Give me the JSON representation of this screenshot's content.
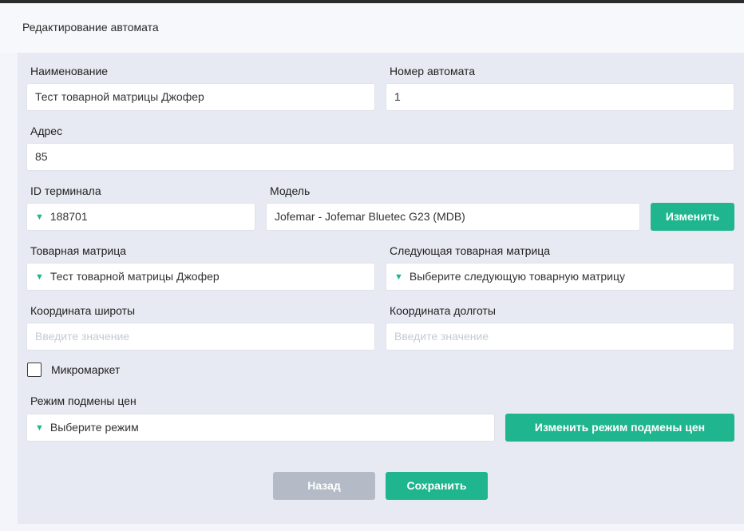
{
  "header": {
    "title": "Редактирование автомата"
  },
  "form": {
    "name": {
      "label": "Наименование",
      "value": "Тест товарной матрицы Джофер"
    },
    "machine_number": {
      "label": "Номер автомата",
      "value": "1"
    },
    "address": {
      "label": "Адрес",
      "value": "85"
    },
    "terminal_id": {
      "label": "ID терминала",
      "value": "188701",
      "icon": "dropdown-triangle-icon"
    },
    "model": {
      "label": "Модель",
      "value": "Jofemar - Jofemar Bluetec G23 (MDB)",
      "button": "Изменить"
    },
    "product_matrix": {
      "label": "Товарная матрица",
      "value": "Тест товарной матрицы Джофер"
    },
    "next_product_matrix": {
      "label": "Следующая товарная матрица",
      "placeholder": "Выберите следующую товарную матрицу"
    },
    "latitude": {
      "label": "Координата широты",
      "placeholder": "Введите значение"
    },
    "longitude": {
      "label": "Координата долготы",
      "placeholder": "Введите значение"
    },
    "micromarket": {
      "label": "Микромаркет",
      "checked": false
    },
    "price_mode": {
      "label": "Режим подмены цен",
      "placeholder": "Выберите режим",
      "button": "Изменить режим подмены цен"
    }
  },
  "actions": {
    "back": "Назад",
    "save": "Сохранить"
  },
  "colors": {
    "accent": "#1fb58f",
    "secondary_button": "#b4bbc7",
    "panel": "#e7eaf2"
  }
}
